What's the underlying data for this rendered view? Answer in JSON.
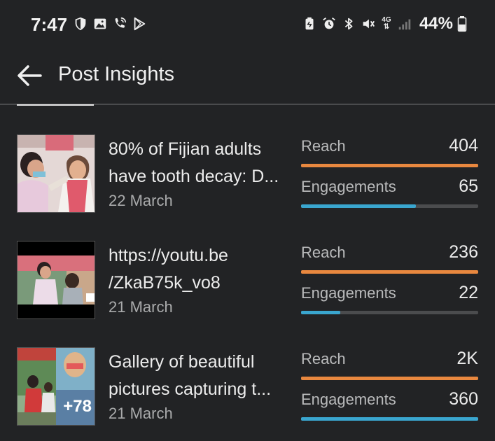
{
  "status_bar": {
    "time": "7:47",
    "network": "4G",
    "battery": "44%"
  },
  "header": {
    "title": "Post Insights"
  },
  "colors": {
    "reach_bar": "#e9883f",
    "engagement_bar": "#3aa6cf",
    "track": "#4b4c4e"
  },
  "posts": [
    {
      "title_line1": "80% of Fijian adults",
      "title_line2": "have tooth decay: D...",
      "date": "22 March",
      "reach_label": "Reach",
      "reach_value": "404",
      "reach_fill": 1.0,
      "engagement_label": "Engagements",
      "engagement_value": "65",
      "engagement_fill": 0.65
    },
    {
      "title_line1": "https://youtu.be",
      "title_line2": "/ZkaB75k_vo8",
      "date": "21 March",
      "reach_label": "Reach",
      "reach_value": "236",
      "reach_fill": 1.0,
      "engagement_label": "Engagements",
      "engagement_value": "22",
      "engagement_fill": 0.22
    },
    {
      "title_line1": "Gallery of beautiful",
      "title_line2": "pictures capturing t...",
      "date": "21 March",
      "reach_label": "Reach",
      "reach_value": "2K",
      "reach_fill": 1.0,
      "engagement_label": "Engagements",
      "engagement_value": "360",
      "engagement_fill": 1.0,
      "thumb_badge": "+78"
    }
  ]
}
